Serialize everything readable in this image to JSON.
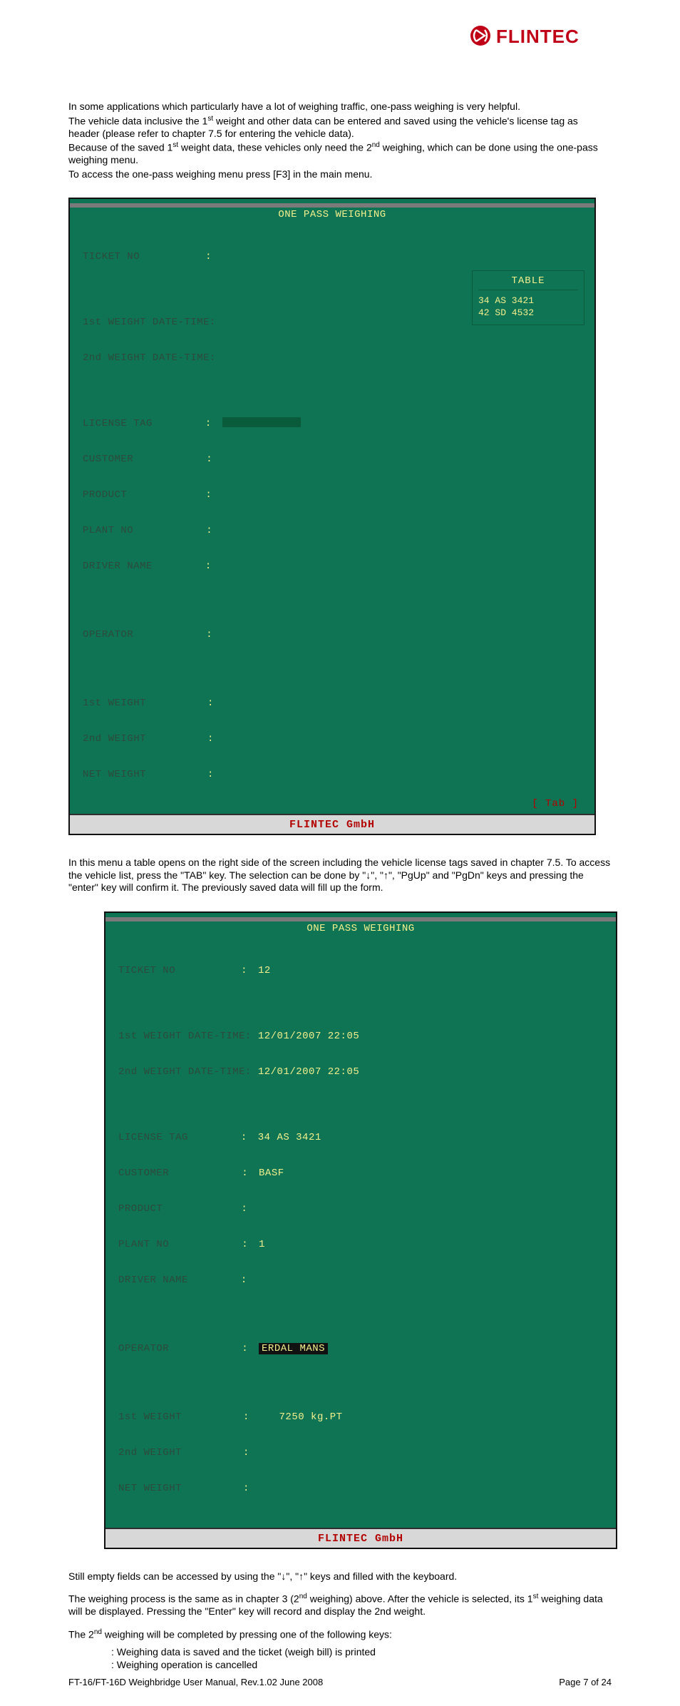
{
  "logo_text": "FLINTEC",
  "para1_a": "In some applications which particularly have a lot of weighing traffic, one-pass weighing is very helpful.",
  "para1_b_pre": "The vehicle data inclusive the 1",
  "para1_b_sup": "st",
  "para1_b_post": " weight and other data can be entered and saved using the vehicle's license tag as header (please refer to chapter 7.5 for entering the vehicle data).",
  "para1_c_pre": "Because of the saved 1",
  "para1_c_sup1": "st",
  "para1_c_mid": " weight data, these vehicles only need the 2",
  "para1_c_sup2": "nd",
  "para1_c_post": " weighing, which can be done using the one-pass weighing menu.",
  "para1_d": "To access the one-pass weighing menu press [F3] in the main menu.",
  "term": {
    "title": "ONE PASS WEIGHING",
    "fields": {
      "ticket_no": "TICKET NO",
      "w1dt": "1st WEIGHT DATE-TIME:",
      "w2dt": "2nd WEIGHT DATE-TIME:",
      "license": "LICENSE TAG",
      "customer": "CUSTOMER",
      "product": "PRODUCT",
      "plant": "PLANT NO",
      "driver": "DRIVER NAME",
      "operator": "OPERATOR",
      "w1": "1st WEIGHT",
      "w2": "2nd WEIGHT",
      "net": "NET WEIGHT"
    },
    "panel": {
      "header": "TABLE",
      "rows": [
        "34 AS 3421",
        "42 SD 4532"
      ],
      "tab": "[ Tab ]"
    },
    "footer": "FLINTEC GmbH"
  },
  "para2": "In this menu a table opens on the right side of the screen including the vehicle license tags saved in chapter 7.5. To access the vehicle list, press the \"TAB\" key. The selection can be done by \"↓\", \"↑\", \"PgUp\" and \"PgDn\" keys and pressing the \"enter\" key will confirm it. The previously saved data will fill up the form.",
  "term2vals": {
    "ticket_no": "12",
    "w1dt": "12/01/2007 22:05",
    "w2dt": "12/01/2007 22:05",
    "license": "34 AS 3421",
    "customer": "BASF",
    "product": "",
    "plant": "1",
    "driver": "",
    "operator": "ERDAL MANS",
    "w1": "   7250 kg.PT",
    "w2": "",
    "net": ""
  },
  "para3": "Still empty fields can be accessed by using the \"↓\", \"↑\" keys and filled with the keyboard.",
  "para4_pre": "The weighing process is the same as in chapter 3 (2",
  "para4_sup1": "nd",
  "para4_mid": " weighing) above. After the vehicle is selected, its 1",
  "para4_sup2": "st",
  "para4_post": " weighing data will be displayed. Pressing the \"Enter\" key will record and display the 2nd weight.",
  "para5_pre": "The 2",
  "para5_sup": "nd",
  "para5_post": " weighing will be completed by pressing one of the following keys:",
  "bullet1": ":    Weighing data is saved and the ticket (weigh bill) is printed",
  "bullet2": ":    Weighing operation is cancelled",
  "footer_left": "FT-16/FT-16D Weighbridge User Manual, Rev.1.02   June 2008",
  "footer_right": "Page 7 of 24"
}
